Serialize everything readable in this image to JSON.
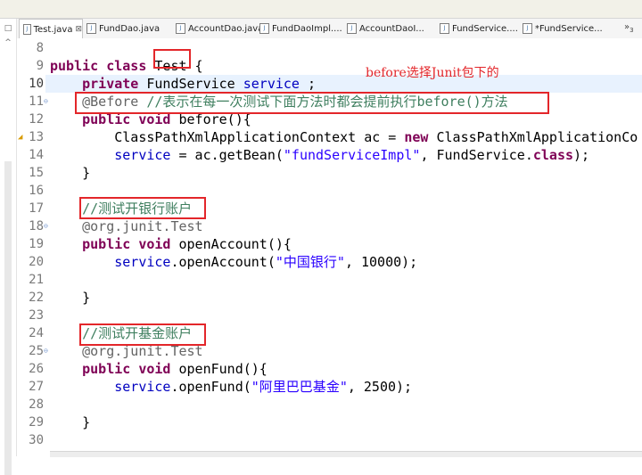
{
  "tabs": [
    {
      "label": "Test.java",
      "icon": "java-file-icon",
      "active": true,
      "close": "⊠"
    },
    {
      "label": "FundDao.java",
      "icon": "java-file-icon"
    },
    {
      "label": "AccountDao.java",
      "icon": "java-file-icon"
    },
    {
      "label": "FundDaoImpl....",
      "icon": "java-file-icon"
    },
    {
      "label": "AccountDaoI...",
      "icon": "java-file-icon"
    },
    {
      "label": "FundService....",
      "icon": "java-file-icon"
    },
    {
      "label": "*FundService...",
      "icon": "java-file-icon"
    }
  ],
  "tab_overflow": "»",
  "tab_overflow_count": "3",
  "annotation_note": "before选择Junit包下的",
  "current_line": "10",
  "lines": [
    {
      "n": "8"
    },
    {
      "n": "9",
      "t": [
        {
          "c": "kw",
          "v": "public class"
        },
        {
          "v": " Test {"
        }
      ]
    },
    {
      "n": "10",
      "t": [
        {
          "v": "    "
        },
        {
          "c": "kw",
          "v": "private"
        },
        {
          "v": " FundService "
        },
        {
          "c": "fld",
          "v": "service"
        },
        {
          "v": " ;"
        }
      ]
    },
    {
      "n": "11",
      "fold": true,
      "t": [
        {
          "v": "    "
        },
        {
          "c": "ann",
          "v": "@Before"
        },
        {
          "v": " "
        },
        {
          "c": "cm",
          "v": "//表示在每一次测试下面方法时都会提前执行before()方法"
        }
      ]
    },
    {
      "n": "12",
      "t": [
        {
          "v": "    "
        },
        {
          "c": "kw",
          "v": "public void"
        },
        {
          "v": " before(){"
        }
      ]
    },
    {
      "n": "13",
      "warn": true,
      "t": [
        {
          "v": "        ClassPathXmlApplicationContext "
        },
        {
          "v": "ac"
        },
        {
          "v": " = "
        },
        {
          "c": "kw",
          "v": "new"
        },
        {
          "v": " ClassPathXmlApplicationCo"
        }
      ]
    },
    {
      "n": "14",
      "t": [
        {
          "v": "        "
        },
        {
          "c": "fld",
          "v": "service"
        },
        {
          "v": " = ac.getBean("
        },
        {
          "c": "str",
          "v": "\"fundServiceImpl\""
        },
        {
          "v": ", FundService."
        },
        {
          "c": "kw",
          "v": "class"
        },
        {
          "v": ");"
        }
      ]
    },
    {
      "n": "15",
      "t": [
        {
          "v": "    }"
        }
      ]
    },
    {
      "n": "16"
    },
    {
      "n": "17",
      "t": [
        {
          "v": "    "
        },
        {
          "c": "cm",
          "v": "//测试开银行账户"
        }
      ]
    },
    {
      "n": "18",
      "fold": true,
      "t": [
        {
          "v": "    "
        },
        {
          "c": "ann",
          "v": "@org.junit.Test"
        }
      ]
    },
    {
      "n": "19",
      "t": [
        {
          "v": "    "
        },
        {
          "c": "kw",
          "v": "public void"
        },
        {
          "v": " openAccount(){"
        }
      ]
    },
    {
      "n": "20",
      "t": [
        {
          "v": "        "
        },
        {
          "c": "fld",
          "v": "service"
        },
        {
          "v": ".openAccount("
        },
        {
          "c": "str",
          "v": "\"中国银行\""
        },
        {
          "v": ", 10000);"
        }
      ]
    },
    {
      "n": "21"
    },
    {
      "n": "22",
      "t": [
        {
          "v": "    }"
        }
      ]
    },
    {
      "n": "23"
    },
    {
      "n": "24",
      "t": [
        {
          "v": "    "
        },
        {
          "c": "cm",
          "v": "//测试开基金账户"
        }
      ]
    },
    {
      "n": "25",
      "fold": true,
      "t": [
        {
          "v": "    "
        },
        {
          "c": "ann",
          "v": "@org.junit.Test"
        }
      ]
    },
    {
      "n": "26",
      "t": [
        {
          "v": "    "
        },
        {
          "c": "kw",
          "v": "public void"
        },
        {
          "v": " openFund(){"
        }
      ]
    },
    {
      "n": "27",
      "t": [
        {
          "v": "        "
        },
        {
          "c": "fld",
          "v": "service"
        },
        {
          "v": ".openFund("
        },
        {
          "c": "str",
          "v": "\"阿里巴巴基金\""
        },
        {
          "v": ", 2500);"
        }
      ]
    },
    {
      "n": "28"
    },
    {
      "n": "29",
      "t": [
        {
          "v": "    }"
        }
      ]
    },
    {
      "n": "30"
    }
  ],
  "colors": {
    "keyword": "#7f0055",
    "field": "#0000c0",
    "string": "#2a00ff",
    "comment": "#3f7f5f",
    "annotation": "#646464",
    "highlight_box": "#e3262a"
  }
}
